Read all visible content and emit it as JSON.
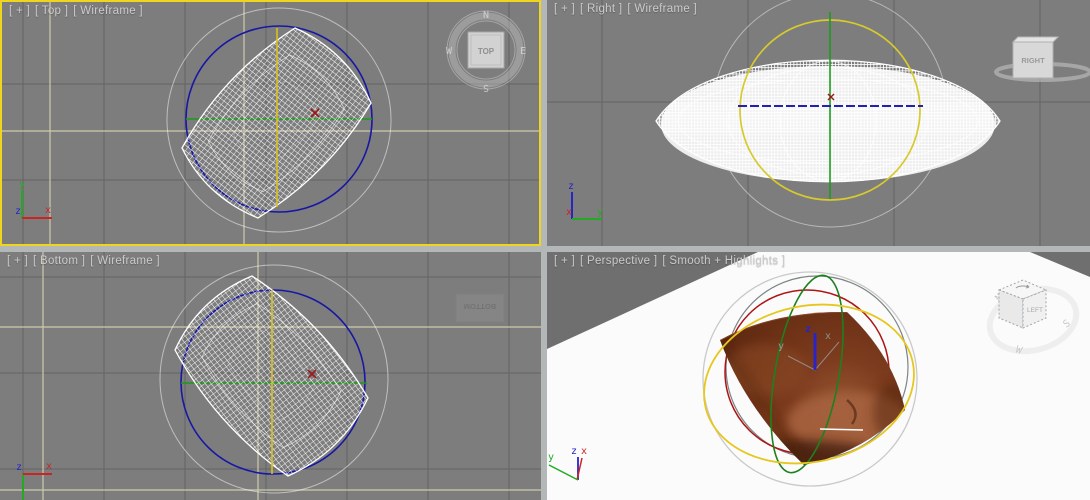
{
  "colors": {
    "vp-bg": "#7d7d7d",
    "splitter": "#b3b7b7",
    "active-border": "#efd51c",
    "label": "#cbcbcb",
    "grid-dark": "#646464",
    "grid-pale": "#d8d3ae",
    "circle-blue": "#1717a5",
    "line-green": "#1d9a1d",
    "line-yellow": "#d8c21e",
    "circle-yellow": "#d6ca2e",
    "line-blue": "#2222ad",
    "marker-red": "#9b1818",
    "wire-white": "#ffffff",
    "sky-gray": "#6f6f6f",
    "gizmo-red": "#ad1414",
    "gizmo-green": "#1d811d",
    "gizmo-yellow": "#e6c71e",
    "gizmo-slate": "#7c8486",
    "gizmo-light": "#d6d6d6",
    "pillow-brown": "#7d3c1e",
    "axis-x-red": "#cc2222",
    "axis-y-green": "#22aa22",
    "axis-z-blue": "#2824c8"
  },
  "viewports": {
    "top": {
      "plus": "[ + ]",
      "view": "[ Top ]",
      "shading": "[ Wireframe ]",
      "viewcube_face": "TOP",
      "compass": {
        "n": "N",
        "e": "E",
        "s": "S",
        "w": "W"
      },
      "axes": {
        "x": "x",
        "y": "y",
        "z": "z"
      }
    },
    "right": {
      "plus": "[ + ]",
      "view": "[ Right ]",
      "shading": "[ Wireframe ]",
      "viewcube_face": "RIGHT",
      "axes": {
        "x": "x",
        "y": "y",
        "z": "z"
      }
    },
    "bottom": {
      "plus": "[ + ]",
      "view": "[ Bottom ]",
      "shading": "[ Wireframe ]",
      "viewcube_face": "BOTTOM",
      "axes": {
        "x": "x",
        "z": "z"
      }
    },
    "perspective": {
      "plus": "[ + ]",
      "view": "[ Perspective ]",
      "shading": "[ Smooth + Highlights ]",
      "viewcube_face": "LEFT",
      "compass": {
        "n": "N",
        "s": "S",
        "w": "W"
      },
      "axes": {
        "x": "x",
        "y": "y",
        "z": "z"
      },
      "gizmo_axes": {
        "x": "x",
        "y": "y",
        "z": "z"
      }
    }
  }
}
